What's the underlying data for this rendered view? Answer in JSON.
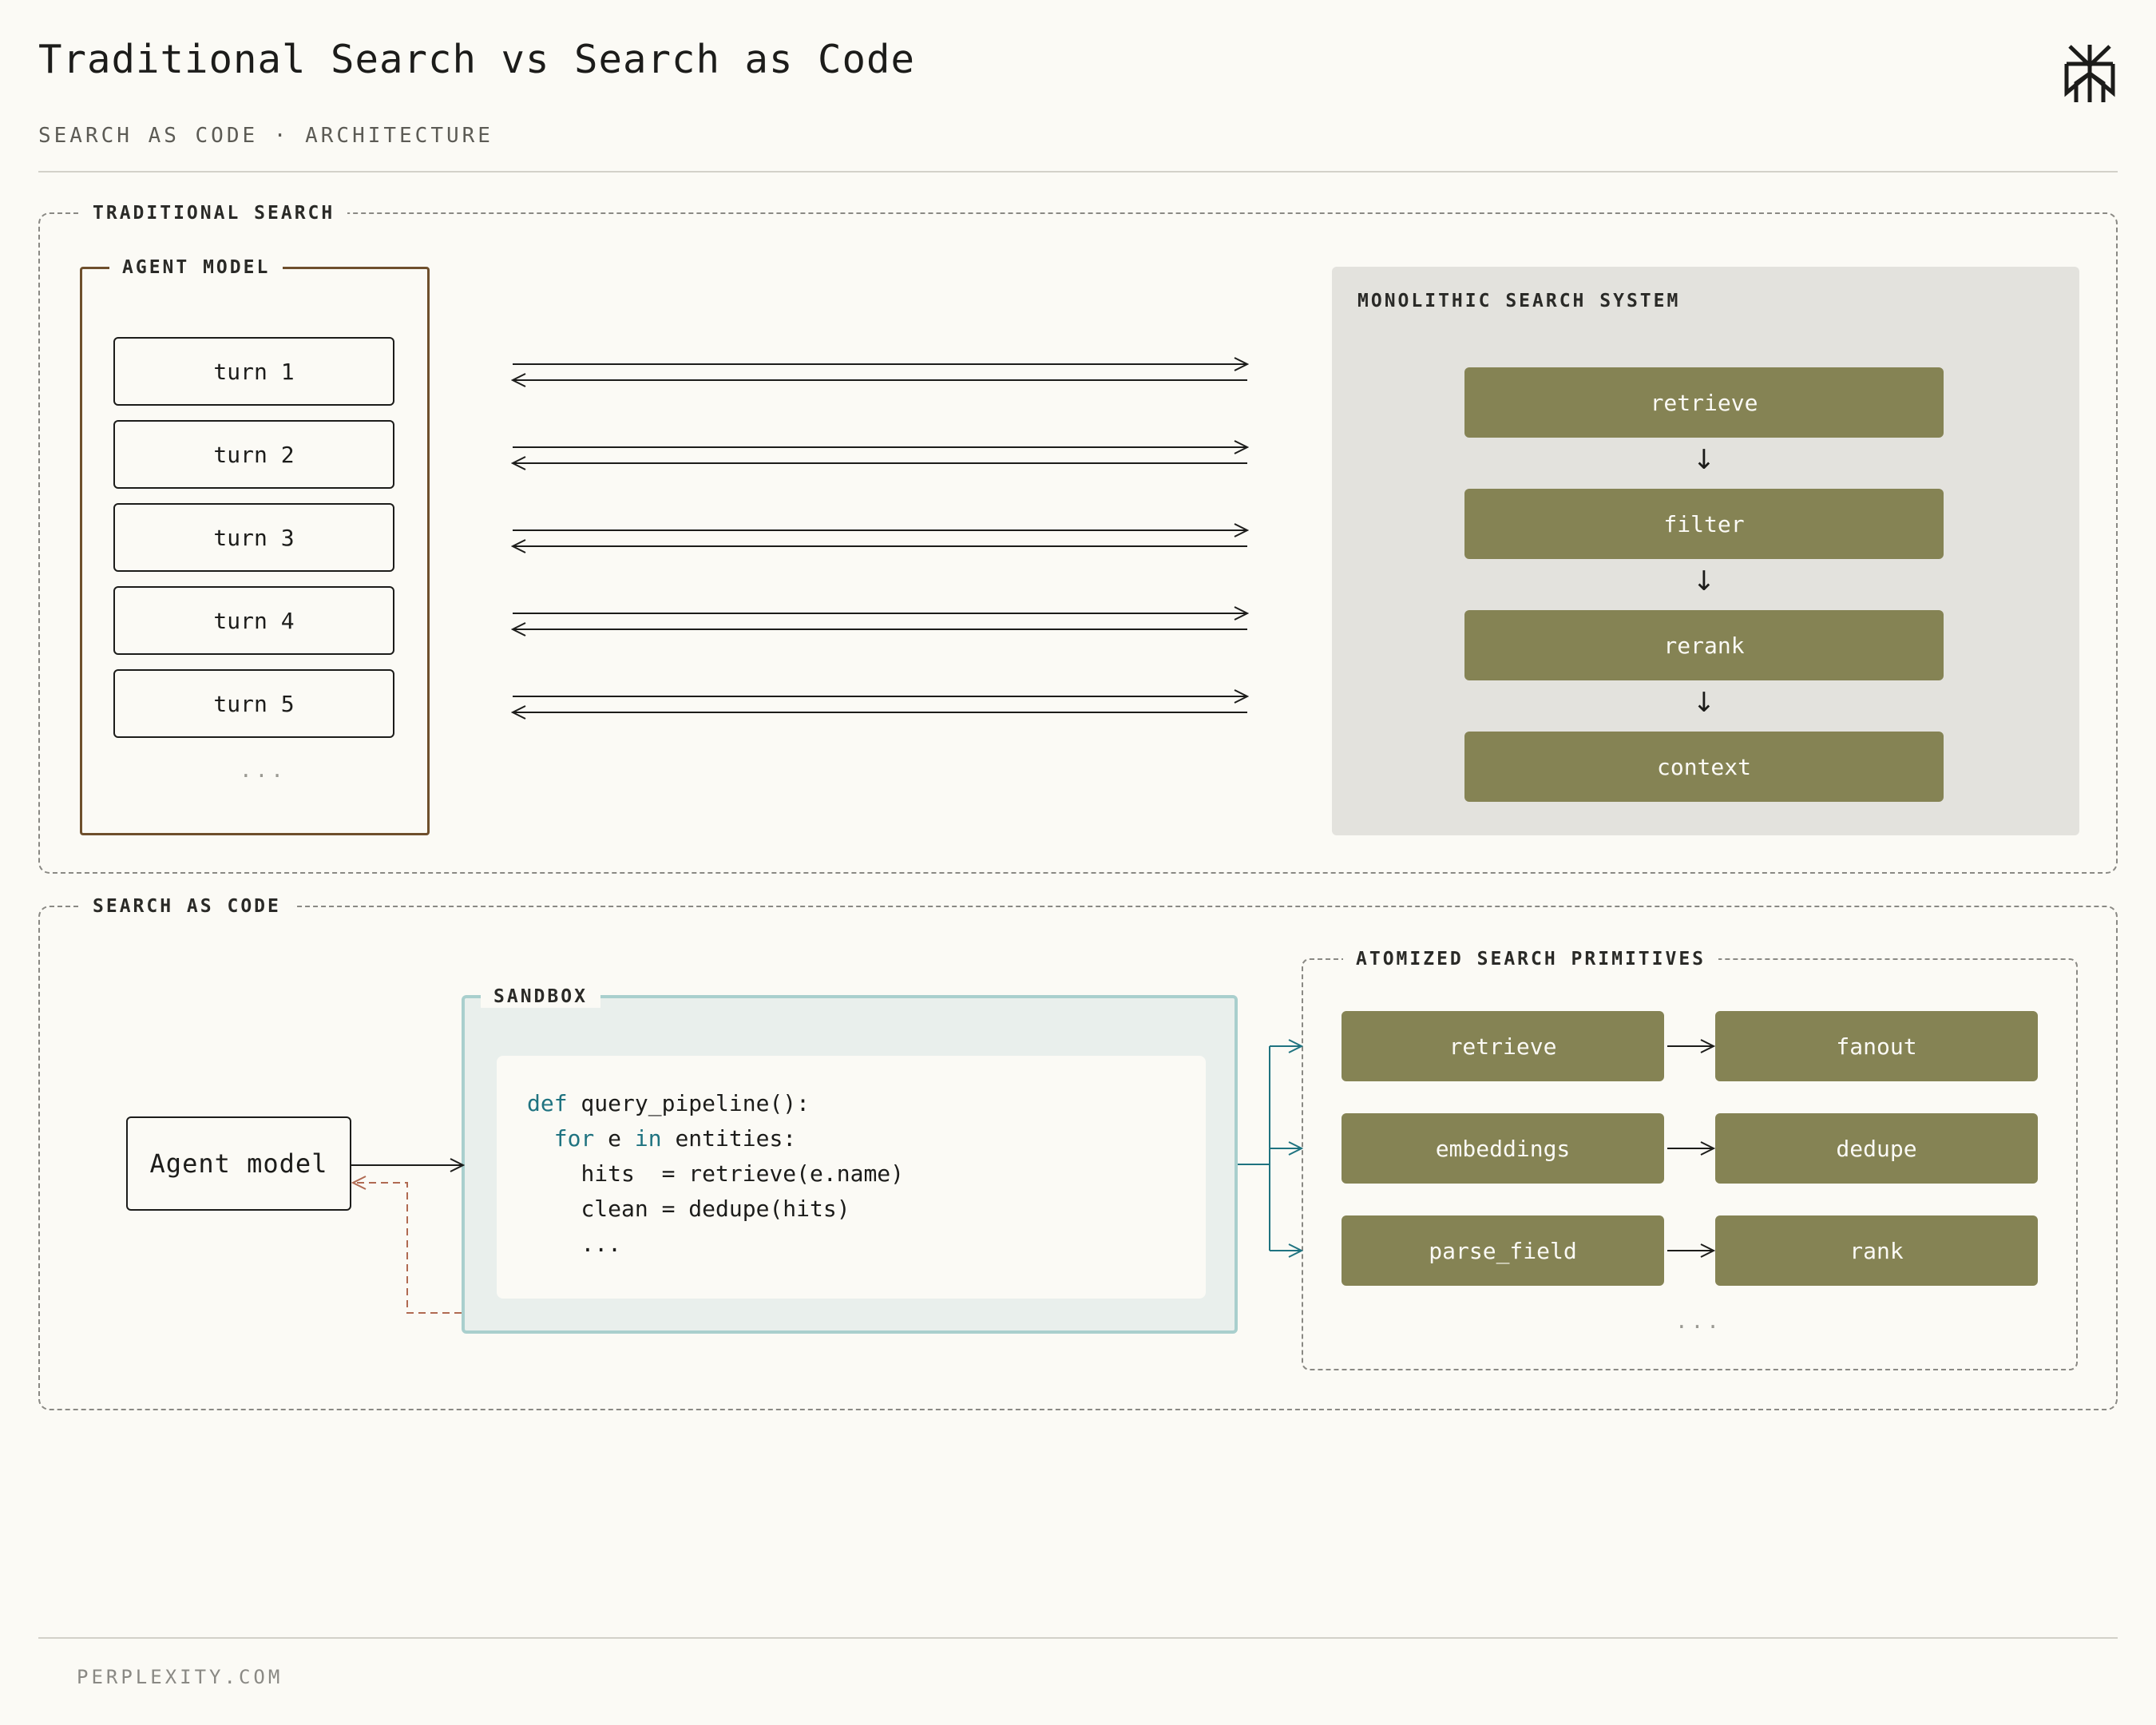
{
  "header": {
    "title": "Traditional Search vs Search as Code",
    "subtitle": "SEARCH AS CODE · ARCHITECTURE",
    "logo_icon": "perplexity-logo-icon"
  },
  "traditional": {
    "legend": "TRADITIONAL SEARCH",
    "agent_model": {
      "legend": "AGENT MODEL",
      "turns": [
        "turn 1",
        "turn 2",
        "turn 3",
        "turn 4",
        "turn 5"
      ],
      "more": "..."
    },
    "monolithic": {
      "title": "MONOLITHIC SEARCH SYSTEM",
      "steps": [
        "retrieve",
        "filter",
        "rerank",
        "context"
      ]
    }
  },
  "search_as_code": {
    "legend": "SEARCH AS CODE",
    "agent_model_label": "Agent model",
    "sandbox": {
      "legend": "SANDBOX",
      "code": {
        "line1_kw": "def",
        "line1_rest": " query_pipeline():",
        "line2_kw1": "for",
        "line2_mid": " e ",
        "line2_kw2": "in",
        "line2_rest": " entities:",
        "line3": "hits  = retrieve(e.name)",
        "line4": "clean = dedupe(hits)",
        "line5": "..."
      }
    },
    "primitives": {
      "legend": "ATOMIZED SEARCH PRIMITIVES",
      "rows": [
        {
          "left": "retrieve",
          "right": "fanout"
        },
        {
          "left": "embeddings",
          "right": "dedupe"
        },
        {
          "left": "parse_field",
          "right": "rank"
        }
      ],
      "more": "..."
    }
  },
  "footer": {
    "text": "PERPLEXITY.COM"
  },
  "colors": {
    "background": "#fbfaf5",
    "olive": "#858354",
    "agent_border": "#6e4f2c",
    "sandbox_border": "#a9cfcd",
    "keyword": "#1f7380",
    "return_arrow": "#b06a52"
  }
}
